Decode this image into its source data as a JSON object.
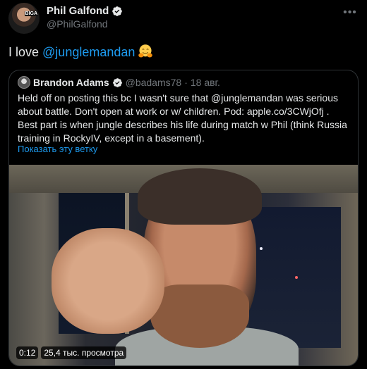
{
  "author": {
    "name": "Phil Galfond",
    "handle": "@PhilGalfond",
    "avatar_label": "BIGA"
  },
  "tweet": {
    "prefix": "I love ",
    "mention": "@junglemandan",
    "emoji": "hugging-face-emoji"
  },
  "quote": {
    "name": "Brandon Adams",
    "handle": "@badams78",
    "separator": "·",
    "date": "18 авг.",
    "text": "Held off on posting this bc I wasn't sure that @junglemandan was serious about battle. Don't open at work or w/ children. Pod: apple.co/3CWjOfj . Best part is when jungle describes his life during match w Phil (think Russia training in RockyIV, except in a basement).",
    "show_thread": "Показать эту ветку"
  },
  "video": {
    "time": "0:12",
    "views": "25,4 тыс. просмотра"
  },
  "colors": {
    "accent": "#1d9bf0",
    "background": "#000000",
    "muted": "#71767b"
  }
}
